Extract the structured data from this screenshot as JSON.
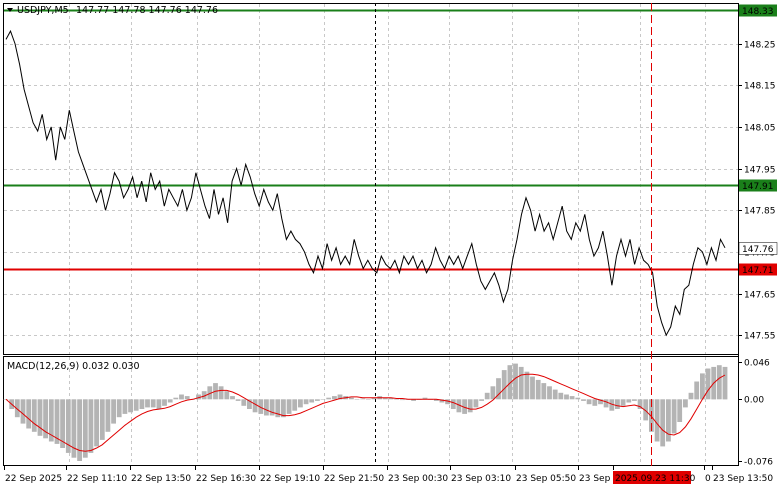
{
  "header": {
    "symbol": "USDJPY,M5",
    "ohlc": "147.77 147.78 147.76 147.76"
  },
  "indicator": {
    "label": "MACD(12,26,9) 0.032 0.030",
    "axis_labels": [
      "0.046",
      "0.00",
      "-0.076"
    ],
    "ylim": [
      -0.076,
      0.046
    ]
  },
  "price_axis": {
    "labels": [
      "148.25",
      "148.15",
      "148.05",
      "147.95",
      "147.85",
      "147.75",
      "147.65",
      "147.55"
    ],
    "ylim": [
      147.505,
      148.345
    ]
  },
  "time_axis": {
    "labels": [
      "22 Sep 2025",
      "22 Sep 11:10",
      "22 Sep 13:50",
      "22 Sep 16:30",
      "22 Sep 19:10",
      "22 Sep 21:50",
      "23 Sep 00:30",
      "23 Sep 03:10",
      "23 Sep 05:50",
      "23 Sep",
      "2025.09.23 11:30",
      "0",
      "23 Sep 13:50"
    ],
    "highlight": "2025.09.23 11:30"
  },
  "levels": [
    {
      "price": 148.33,
      "label": "148.33",
      "color": "#1a7f1a"
    },
    {
      "price": 147.91,
      "label": "147.91",
      "color": "#1a7f1a"
    },
    {
      "price": 147.71,
      "label": "147.71",
      "color": "#e00000"
    },
    {
      "price": 147.76,
      "label": "147.76",
      "color": "#000000",
      "current": true
    }
  ],
  "colors": {
    "price_line": "#000000",
    "macd_hist": "#b4b4b4",
    "signal_line": "#e00000",
    "grid": "#c8c8c8",
    "highlight_bg": "#e00000"
  },
  "chart_data": {
    "type": "line",
    "series": [
      {
        "values": [
          148.26,
          148.28,
          148.25,
          148.2,
          148.14,
          148.1,
          148.06,
          148.04,
          148.08,
          148.02,
          148.05,
          147.97,
          148.05,
          148.02,
          148.09,
          148.04,
          147.99,
          147.96,
          147.93,
          147.9,
          147.87,
          147.9,
          147.85,
          147.89,
          147.94,
          147.92,
          147.88,
          147.9,
          147.93,
          147.88,
          147.92,
          147.87,
          147.94,
          147.9,
          147.92,
          147.86,
          147.9,
          147.88,
          147.86,
          147.9,
          147.85,
          147.88,
          147.94,
          147.9,
          147.86,
          147.83,
          147.9,
          147.84,
          147.88,
          147.82,
          147.92,
          147.95,
          147.91,
          147.96,
          147.93,
          147.89,
          147.86,
          147.9,
          147.87,
          147.85,
          147.89,
          147.83,
          147.78,
          147.8,
          147.78,
          147.77,
          147.75,
          147.72,
          147.7,
          147.74,
          147.71,
          147.77,
          147.73,
          147.76,
          147.72,
          147.74,
          147.72,
          147.78,
          147.74,
          147.71,
          147.73,
          147.71,
          147.7,
          147.74,
          147.72,
          147.71,
          147.73,
          147.7,
          147.74,
          147.72,
          147.74,
          147.71,
          147.73,
          147.7,
          147.72,
          147.76,
          147.73,
          147.71,
          147.74,
          147.72,
          147.74,
          147.71,
          147.74,
          147.77,
          147.72,
          147.68,
          147.66,
          147.68,
          147.7,
          147.67,
          147.63,
          147.66,
          147.73,
          147.78,
          147.84,
          147.88,
          147.85,
          147.8,
          147.84,
          147.8,
          147.82,
          147.78,
          147.82,
          147.86,
          147.8,
          147.78,
          147.82,
          147.8,
          147.84,
          147.78,
          147.74,
          147.76,
          147.8,
          147.74,
          147.67,
          147.74,
          147.78,
          147.74,
          147.78,
          147.72,
          147.76,
          147.73,
          147.72,
          147.7,
          147.62,
          147.58,
          147.55,
          147.57,
          147.62,
          147.6,
          147.66,
          147.67,
          147.72,
          147.76,
          147.75,
          147.72,
          147.76,
          147.73,
          147.78,
          147.76
        ]
      }
    ],
    "macd": {
      "hist": [
        0.0,
        -0.012,
        -0.022,
        -0.03,
        -0.036,
        -0.04,
        -0.045,
        -0.048,
        -0.052,
        -0.055,
        -0.06,
        -0.066,
        -0.072,
        -0.076,
        -0.072,
        -0.066,
        -0.058,
        -0.05,
        -0.04,
        -0.03,
        -0.022,
        -0.018,
        -0.016,
        -0.014,
        -0.012,
        -0.01,
        -0.01,
        -0.012,
        -0.008,
        -0.004,
        0.002,
        0.006,
        0.004,
        0.0,
        0.006,
        0.01,
        0.016,
        0.02,
        0.016,
        0.01,
        0.004,
        -0.002,
        -0.008,
        -0.012,
        -0.016,
        -0.018,
        -0.02,
        -0.02,
        -0.022,
        -0.022,
        -0.018,
        -0.014,
        -0.01,
        -0.006,
        -0.004,
        -0.002,
        0.0,
        0.002,
        0.004,
        0.006,
        0.004,
        0.002,
        0.0,
        0.001,
        0.0,
        0.002,
        0.004,
        0.002,
        0.002,
        0.0,
        -0.001,
        0.0,
        -0.002,
        0.0,
        0.002,
        0.0,
        -0.002,
        -0.004,
        -0.006,
        -0.012,
        -0.016,
        -0.018,
        -0.016,
        -0.01,
        -0.002,
        0.008,
        0.016,
        0.026,
        0.036,
        0.042,
        0.044,
        0.04,
        0.034,
        0.028,
        0.024,
        0.02,
        0.016,
        0.012,
        0.008,
        0.006,
        0.004,
        0.002,
        -0.002,
        -0.006,
        -0.008,
        -0.006,
        -0.01,
        -0.014,
        -0.012,
        -0.008,
        -0.004,
        -0.002,
        -0.012,
        -0.026,
        -0.04,
        -0.052,
        -0.058,
        -0.052,
        -0.042,
        -0.028,
        -0.01,
        0.008,
        0.022,
        0.032,
        0.038,
        0.04,
        0.042,
        0.04
      ],
      "signal": [
        0.0,
        -0.006,
        -0.012,
        -0.018,
        -0.024,
        -0.03,
        -0.035,
        -0.04,
        -0.044,
        -0.048,
        -0.052,
        -0.056,
        -0.06,
        -0.063,
        -0.064,
        -0.063,
        -0.06,
        -0.056,
        -0.05,
        -0.044,
        -0.038,
        -0.032,
        -0.027,
        -0.022,
        -0.018,
        -0.015,
        -0.013,
        -0.012,
        -0.011,
        -0.009,
        -0.006,
        -0.003,
        -0.001,
        0.0,
        0.002,
        0.004,
        0.007,
        0.01,
        0.011,
        0.011,
        0.009,
        0.006,
        0.002,
        -0.002,
        -0.006,
        -0.01,
        -0.013,
        -0.016,
        -0.018,
        -0.02,
        -0.02,
        -0.019,
        -0.017,
        -0.014,
        -0.011,
        -0.008,
        -0.005,
        -0.003,
        -0.001,
        0.001,
        0.002,
        0.003,
        0.003,
        0.002,
        0.002,
        0.002,
        0.002,
        0.002,
        0.002,
        0.001,
        0.001,
        0.0,
        0.0,
        0.0,
        0.0,
        0.0,
        0.0,
        -0.001,
        -0.002,
        -0.004,
        -0.007,
        -0.01,
        -0.012,
        -0.012,
        -0.01,
        -0.006,
        -0.001,
        0.006,
        0.013,
        0.02,
        0.026,
        0.03,
        0.031,
        0.031,
        0.03,
        0.028,
        0.025,
        0.022,
        0.019,
        0.016,
        0.013,
        0.01,
        0.007,
        0.004,
        0.001,
        -0.001,
        -0.003,
        -0.006,
        -0.008,
        -0.009,
        -0.008,
        -0.007,
        -0.009,
        -0.014,
        -0.021,
        -0.03,
        -0.038,
        -0.043,
        -0.044,
        -0.041,
        -0.034,
        -0.024,
        -0.012,
        0.0,
        0.011,
        0.02,
        0.026,
        0.03
      ]
    }
  }
}
